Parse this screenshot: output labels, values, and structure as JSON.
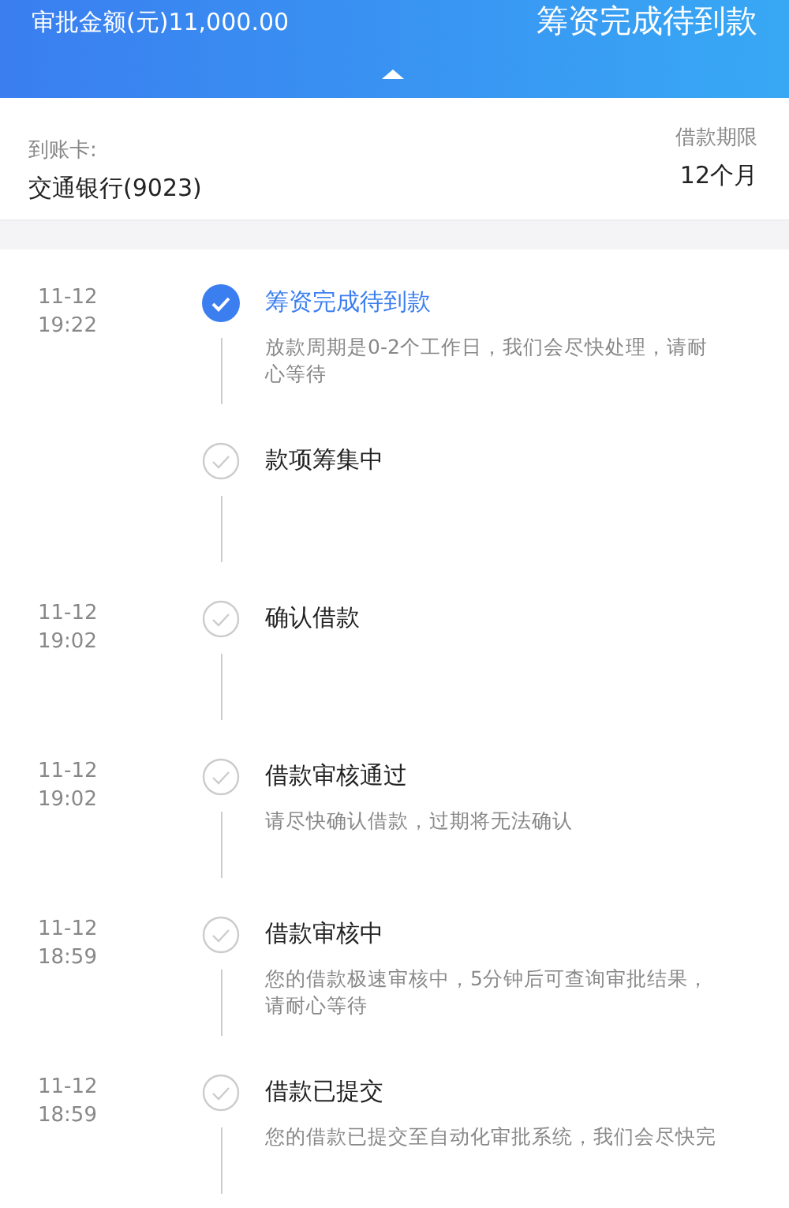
{
  "header": {
    "amount": "审批金额(元)11,000.00",
    "status": "筹资完成待到款"
  },
  "card": {
    "account_label": "到账卡:",
    "account": "交通银行(9023)",
    "term_label": "借款期限",
    "term": "12个月"
  },
  "steps": [
    {
      "date": "11-12",
      "time": "19:22",
      "title": "筹资完成待到款",
      "desc": "放款周期是0-2个工作日，我们会尽快处理，请耐心等待",
      "selected": true
    },
    {
      "title": "款项筹集中",
      "selected": false
    },
    {
      "date": "11-12",
      "time": "19:02",
      "title": "确认借款",
      "selected": false
    },
    {
      "date": "11-12",
      "time": "19:02",
      "title": "借款审核通过",
      "desc": "请尽快确认借款，过期将无法确认",
      "selected": false
    },
    {
      "date": "11-12",
      "time": "18:59",
      "title": "借款审核中",
      "desc": "您的借款极速审核中，5分钟后可查询审批结果，请耐心等待",
      "selected": false
    },
    {
      "date": "11-12",
      "time": "18:59",
      "title": "借款已提交",
      "desc": "您的借款已提交至自动化审批系统，我们会尽快完",
      "selected": false
    }
  ]
}
